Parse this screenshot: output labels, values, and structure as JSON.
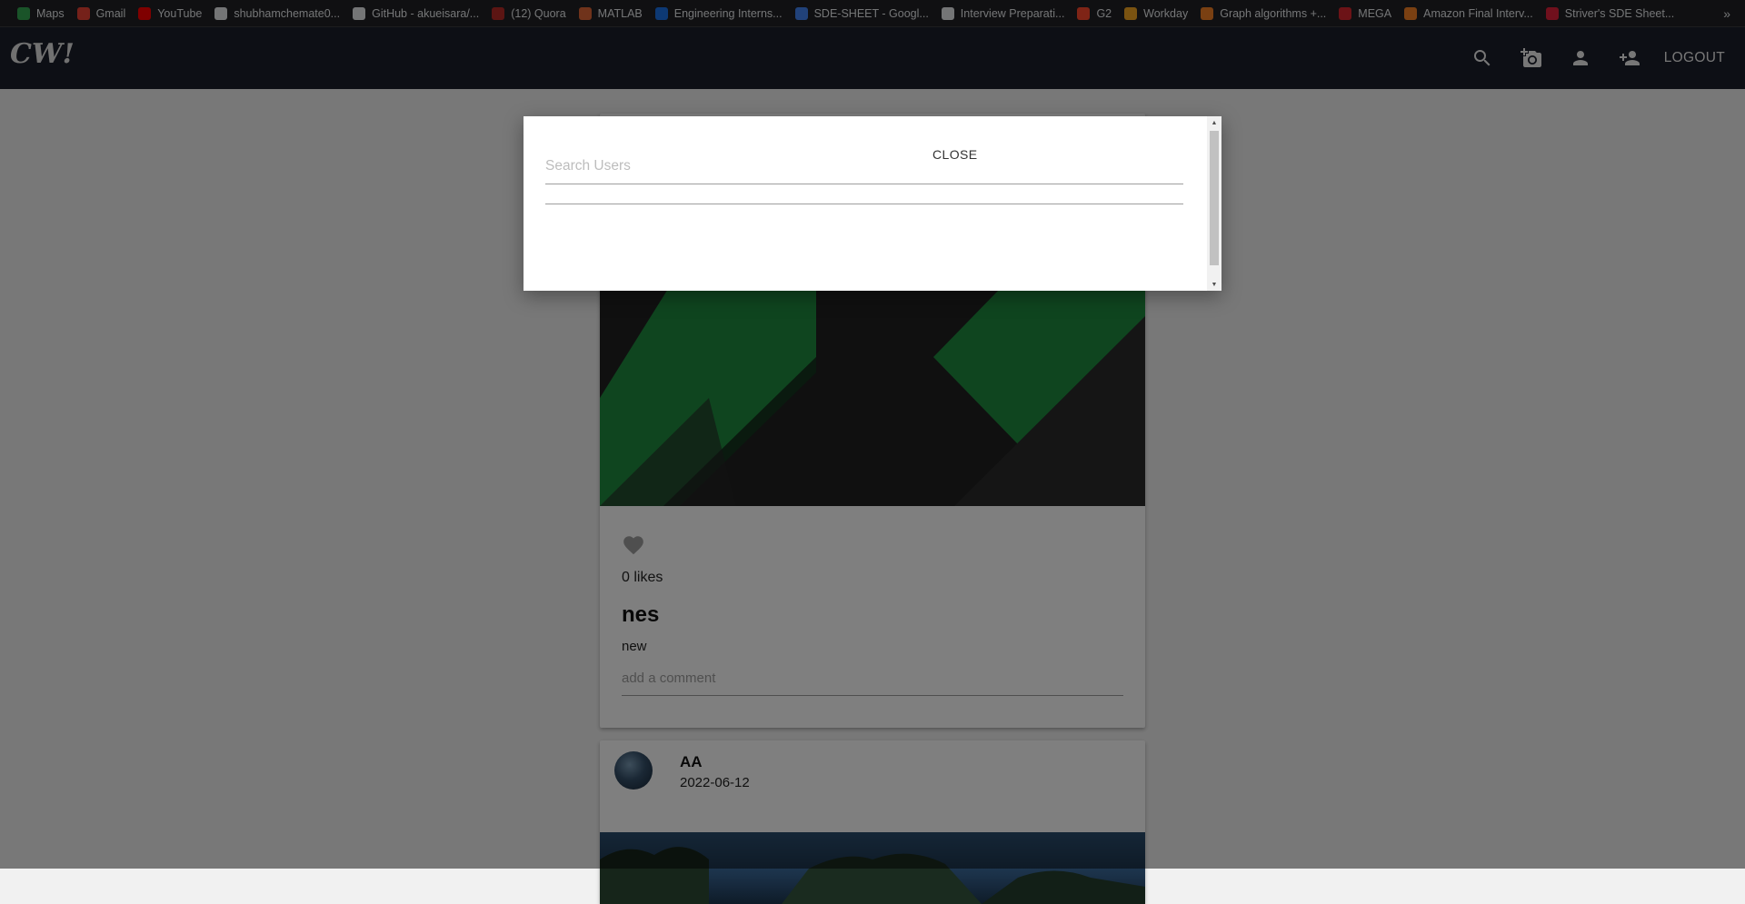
{
  "bookmarks": [
    {
      "label": "Maps",
      "icon": "maps-icon",
      "color": "#34a853"
    },
    {
      "label": "Gmail",
      "icon": "gmail-icon",
      "color": "#ea4335"
    },
    {
      "label": "YouTube",
      "icon": "youtube-icon",
      "color": "#ff0000"
    },
    {
      "label": "shubhamchemate0...",
      "icon": "github-icon",
      "color": "#e8eaed"
    },
    {
      "label": "GitHub - akueisara/...",
      "icon": "github-icon",
      "color": "#e8eaed"
    },
    {
      "label": "(12) Quora",
      "icon": "quora-icon",
      "color": "#b92b27"
    },
    {
      "label": "MATLAB",
      "icon": "matlab-icon",
      "color": "#e16737"
    },
    {
      "label": "Engineering Interns...",
      "icon": "engineering-icon",
      "color": "#1a73e8"
    },
    {
      "label": "SDE-SHEET - Googl...",
      "icon": "google-docs-icon",
      "color": "#4285f4"
    },
    {
      "label": "Interview Preparati...",
      "icon": "interview-icon",
      "color": "#e8eaed"
    },
    {
      "label": "G2",
      "icon": "g2-icon",
      "color": "#ff492c"
    },
    {
      "label": "Workday",
      "icon": "workday-icon",
      "color": "#f5a623"
    },
    {
      "label": "Graph algorithms +...",
      "icon": "stackoverflow-icon",
      "color": "#f48024"
    },
    {
      "label": "MEGA",
      "icon": "mega-icon",
      "color": "#d9272e"
    },
    {
      "label": "Amazon Final Interv...",
      "icon": "stackoverflow-icon",
      "color": "#f48024"
    },
    {
      "label": "Striver's SDE Sheet...",
      "icon": "tuf-icon",
      "color": "#e0203a"
    }
  ],
  "bookmarks_more": "»",
  "app": {
    "logo": "CW!",
    "logout": "LOGOUT"
  },
  "post": {
    "likes": "0 likes",
    "title": "nes",
    "body": "new",
    "comment_placeholder": "add a comment"
  },
  "post2": {
    "username": "AA",
    "date": "2022-06-12"
  },
  "modal": {
    "search_placeholder": "Search Users",
    "close_label": "CLOSE"
  }
}
